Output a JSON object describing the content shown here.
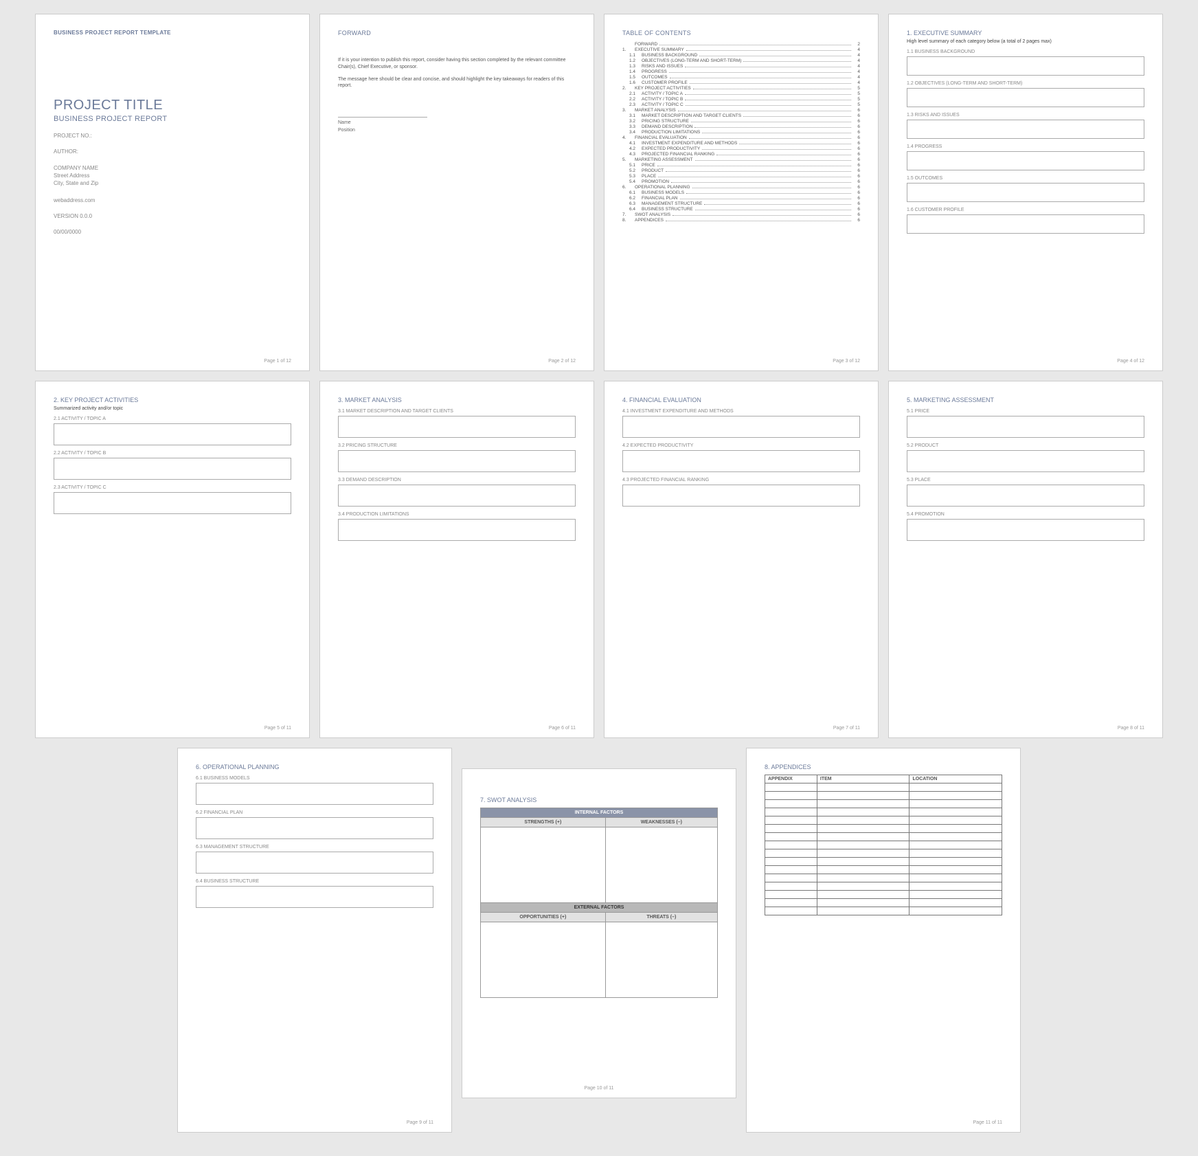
{
  "doc_header": "BUSINESS PROJECT REPORT TEMPLATE",
  "p1": {
    "title": "PROJECT TITLE",
    "subtitle": "BUSINESS PROJECT REPORT",
    "project_no": "PROJECT NO.:",
    "author": "AUTHOR:",
    "company": "COMPANY NAME",
    "street": "Street Address",
    "csz": "City, State and Zip",
    "web": "webaddress.com",
    "version": "VERSION 0.0.0",
    "date": "00/00/0000",
    "footer": "Page 1 of 12"
  },
  "p2": {
    "title": "FORWARD",
    "para1": "If it is your intention to publish this report, consider having this section completed by the relevant committee Chair(s), Chief Executive, or sponsor.",
    "para2": "The message here should be clear and concise, and should highlight the key takeaways for readers of this report.",
    "name": "Name",
    "position": "Position",
    "footer": "Page 2 of 12"
  },
  "p3": {
    "title": "TABLE OF CONTENTS",
    "rows": [
      {
        "n": "",
        "l": "FORWARD",
        "p": "2"
      },
      {
        "n": "1.",
        "l": "EXECUTIVE SUMMARY",
        "p": "4"
      },
      {
        "n": "1.1",
        "l": "BUSINESS BACKGROUND",
        "p": "4",
        "sub": true
      },
      {
        "n": "1.2",
        "l": "OBJECTIVES (LONG-TERM AND SHORT-TERM)",
        "p": "4",
        "sub": true
      },
      {
        "n": "1.3",
        "l": "RISKS AND ISSUES",
        "p": "4",
        "sub": true
      },
      {
        "n": "1.4",
        "l": "PROGRESS",
        "p": "4",
        "sub": true
      },
      {
        "n": "1.5",
        "l": "OUTCOMES",
        "p": "4",
        "sub": true
      },
      {
        "n": "1.6",
        "l": "CUSTOMER PROFILE",
        "p": "4",
        "sub": true
      },
      {
        "n": "2.",
        "l": "KEY PROJECT ACTIVITIES",
        "p": "5"
      },
      {
        "n": "2.1",
        "l": "ACTIVITY / TOPIC A",
        "p": "5",
        "sub": true
      },
      {
        "n": "2.2",
        "l": "ACTIVITY / TOPIC B",
        "p": "5",
        "sub": true
      },
      {
        "n": "2.3",
        "l": "ACTIVITY / TOPIC C",
        "p": "5",
        "sub": true
      },
      {
        "n": "3.",
        "l": "MARKET ANALYSIS",
        "p": "6"
      },
      {
        "n": "3.1",
        "l": "MARKET DESCRIPTION AND TARGET CLIENTS",
        "p": "6",
        "sub": true
      },
      {
        "n": "3.2",
        "l": "PRICING STRUCTURE",
        "p": "6",
        "sub": true
      },
      {
        "n": "3.3",
        "l": "DEMAND DESCRIPTION",
        "p": "6",
        "sub": true
      },
      {
        "n": "3.4",
        "l": "PRODUCTION LIMITATIONS",
        "p": "6",
        "sub": true
      },
      {
        "n": "4.",
        "l": "FINANCIAL EVALUATION",
        "p": "6"
      },
      {
        "n": "4.1",
        "l": "INVESTMENT EXPENDITURE AND METHODS",
        "p": "6",
        "sub": true
      },
      {
        "n": "4.2",
        "l": "EXPECTED PRODUCTIVITY",
        "p": "6",
        "sub": true
      },
      {
        "n": "4.3",
        "l": "PROJECTED FINANCIAL RANKING",
        "p": "6",
        "sub": true
      },
      {
        "n": "5.",
        "l": "MARKETING ASSESSMENT",
        "p": "6"
      },
      {
        "n": "5.1",
        "l": "PRICE",
        "p": "6",
        "sub": true
      },
      {
        "n": "5.2",
        "l": "PRODUCT",
        "p": "6",
        "sub": true
      },
      {
        "n": "5.3",
        "l": "PLACE",
        "p": "6",
        "sub": true
      },
      {
        "n": "5.4",
        "l": "PROMOTION",
        "p": "6",
        "sub": true
      },
      {
        "n": "6.",
        "l": "OPERATIONAL PLANNING",
        "p": "6"
      },
      {
        "n": "6.1",
        "l": "BUSINESS MODELS",
        "p": "6",
        "sub": true
      },
      {
        "n": "6.2",
        "l": "FINANCIAL PLAN",
        "p": "6",
        "sub": true
      },
      {
        "n": "6.3",
        "l": "MANAGEMENT STRUCTURE",
        "p": "6",
        "sub": true
      },
      {
        "n": "6.4",
        "l": "BUSINESS STRUCTURE",
        "p": "6",
        "sub": true
      },
      {
        "n": "7.",
        "l": "SWOT ANALYSIS",
        "p": "6"
      },
      {
        "n": "8.",
        "l": "APPENDICES",
        "p": "6"
      }
    ],
    "footer": "Page 3 of 12"
  },
  "p4": {
    "title": "1. EXECUTIVE SUMMARY",
    "desc": "High level summary of each category below (a total of 2 pages max)",
    "subs": [
      "1.1  BUSINESS BACKGROUND",
      "1.2  OBJECTIVES (LONG-TERM AND SHORT-TERM)",
      "1.3  RISKS AND ISSUES",
      "1.4  PROGRESS",
      "1.5  OUTCOMES",
      "1.6  CUSTOMER PROFILE"
    ],
    "footer": "Page 4 of 12"
  },
  "p5": {
    "title": "2. KEY PROJECT ACTIVITIES",
    "desc": "Summarized activity and/or topic",
    "subs": [
      "2.1  ACTIVITY / TOPIC A",
      "2.2  ACTIVITY / TOPIC B",
      "2.3  ACTIVITY / TOPIC C"
    ],
    "footer": "Page 5 of 11"
  },
  "p6": {
    "title": "3. MARKET ANALYSIS",
    "subs": [
      "3.1  MARKET DESCRIPTION AND TARGET CLIENTS",
      "3.2  PRICING STRUCTURE",
      "3.3  DEMAND DESCRIPTION",
      "3.4  PRODUCTION LIMITATIONS"
    ],
    "footer": "Page 6 of 11"
  },
  "p7": {
    "title": "4. FINANCIAL EVALUATION",
    "subs": [
      "4.1  INVESTMENT EXPENDITURE AND METHODS",
      "4.2  EXPECTED PRODUCTIVITY",
      "4.3  PROJECTED FINANCIAL RANKING"
    ],
    "footer": "Page 7 of 11"
  },
  "p8": {
    "title": "5. MARKETING ASSESSMENT",
    "subs": [
      "5.1  PRICE",
      "5.2  PRODUCT",
      "5.3  PLACE",
      "5.4  PROMOTION"
    ],
    "footer": "Page 8 of 11"
  },
  "p9": {
    "title": "6. OPERATIONAL PLANNING",
    "subs": [
      "6.1  BUSINESS MODELS",
      "6.2  FINANCIAL PLAN",
      "6.3  MANAGEMENT STRUCTURE",
      "6.4  BUSINESS STRUCTURE"
    ],
    "footer": "Page 9 of 11"
  },
  "p10": {
    "title": "7. SWOT ANALYSIS",
    "internal": "INTERNAL FACTORS",
    "strengths": "STRENGTHS (+)",
    "weaknesses": "WEAKNESSES (–)",
    "external": "EXTERNAL FACTORS",
    "opportunities": "OPPORTUNITIES (+)",
    "threats": "THREATS (–)",
    "footer": "Page 10 of 11"
  },
  "p11": {
    "title": "8. APPENDICES",
    "cols": [
      "APPENDIX",
      "ITEM",
      "LOCATION"
    ],
    "rows": 16,
    "footer": "Page 11 of 11"
  }
}
